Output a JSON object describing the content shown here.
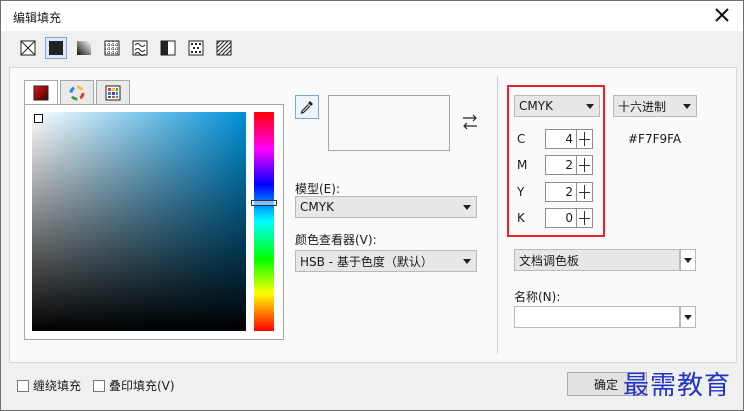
{
  "window": {
    "title": "编辑填充"
  },
  "fill_tools": [
    {
      "name": "no-fill-icon",
      "active": false
    },
    {
      "name": "uniform-fill-icon",
      "active": true
    },
    {
      "name": "fountain-fill-icon",
      "active": false
    },
    {
      "name": "vector-pattern-fill-icon",
      "active": false
    },
    {
      "name": "bitmap-pattern-fill-icon",
      "active": false
    },
    {
      "name": "two-color-pattern-fill-icon",
      "active": false
    },
    {
      "name": "texture-fill-icon",
      "active": false
    },
    {
      "name": "postscript-fill-icon",
      "active": false
    }
  ],
  "color_tabs": [
    "color-viewer-tab",
    "color-wheel-tab",
    "palette-grid-tab"
  ],
  "model": {
    "label": "模型(E):",
    "value": "CMYK"
  },
  "viewer": {
    "label": "颜色查看器(V):",
    "value": "HSB - 基于色度（默认）"
  },
  "right": {
    "model_combo": "CMYK",
    "format_combo": "十六进制",
    "hex": "#F7F9FA",
    "palette_combo": "文档调色板",
    "name_label": "名称(N):",
    "name_value": ""
  },
  "cmyk": [
    {
      "letter": "C",
      "value": "4"
    },
    {
      "letter": "M",
      "value": "2"
    },
    {
      "letter": "Y",
      "value": "2"
    },
    {
      "letter": "K",
      "value": "0"
    }
  ],
  "current_color": "#F7F9FA",
  "bottom": {
    "wrap_fill": "缠绕填充",
    "overprint_fill": "叠印填充(V)",
    "ok": "确定"
  },
  "watermark": "最需教育",
  "colors": {
    "highlight": "#e8202a",
    "watermark": "#2233c8",
    "accent": "#7aa7d8"
  }
}
